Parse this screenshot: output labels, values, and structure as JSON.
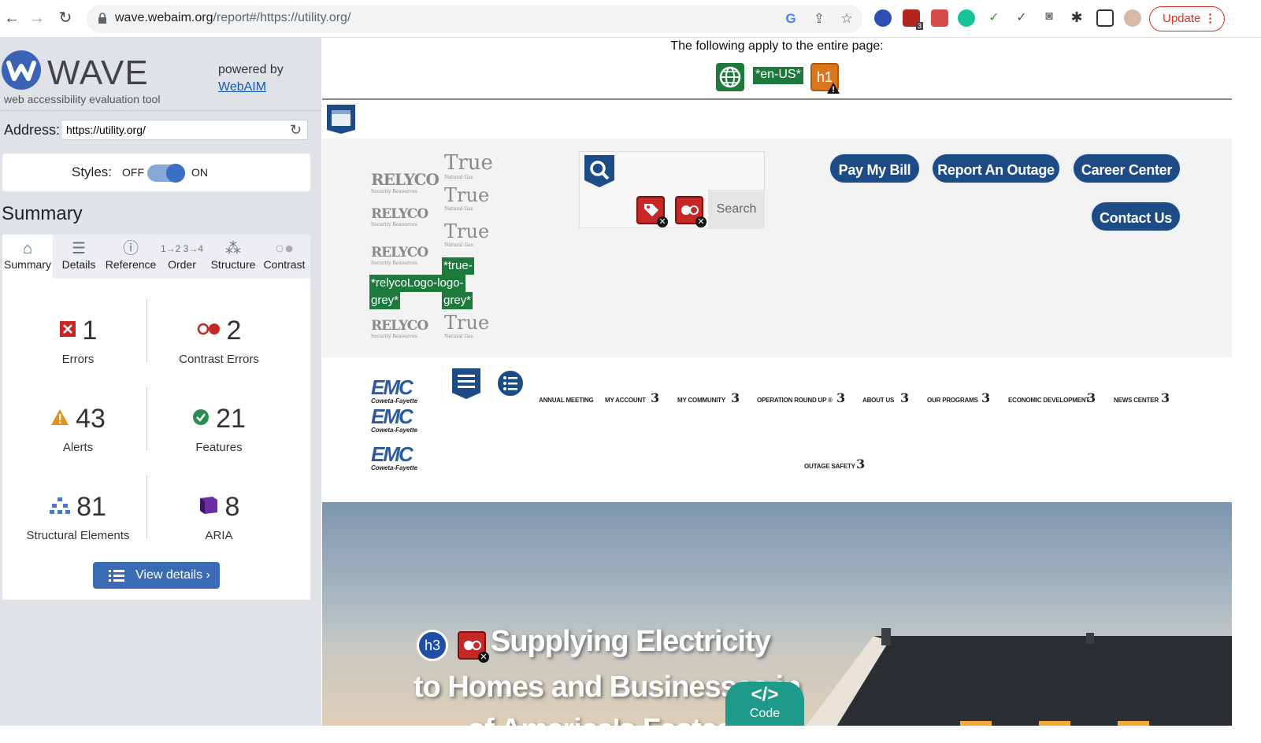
{
  "browser": {
    "url_host": "wave.webaim.org",
    "url_path": "/report#/https://utility.org/",
    "update_label": "Update",
    "ext_badge_count": "3"
  },
  "wave": {
    "logo_title": "WAVE",
    "logo_subtitle": "web accessibility evaluation tool",
    "powered_by": "powered by",
    "webaim_link": "WebAIM",
    "address_label": "Address:",
    "address_value": "https://utility.org/",
    "styles_label": "Styles:",
    "styles_off": "OFF",
    "styles_on": "ON",
    "summary_title": "Summary",
    "tabs": [
      {
        "label": "Summary",
        "icon": "home-icon"
      },
      {
        "label": "Details",
        "icon": "list-icon"
      },
      {
        "label": "Reference",
        "icon": "info-icon"
      },
      {
        "label": "Order",
        "icon": "order-icon"
      },
      {
        "label": "Structure",
        "icon": "structure-icon"
      },
      {
        "label": "Contrast",
        "icon": "contrast-icon"
      }
    ],
    "stats": {
      "errors": {
        "count": "1",
        "label": "Errors"
      },
      "contrast": {
        "count": "2",
        "label": "Contrast Errors"
      },
      "alerts": {
        "count": "43",
        "label": "Alerts"
      },
      "features": {
        "count": "21",
        "label": "Features"
      },
      "structural": {
        "count": "81",
        "label": "Structural Elements"
      },
      "aria": {
        "count": "8",
        "label": "ARIA"
      }
    },
    "view_details": "View details ›"
  },
  "page": {
    "applies_text": "The following apply to the entire page:",
    "lang_badge": "*en-US*",
    "h1_badge": "h1",
    "alt_true": "*true-",
    "alt_relyco": "*relycoLogo-logo-",
    "alt_grey1": "grey*",
    "alt_grey2": "grey*",
    "relyco_logo": "RELYCO",
    "relyco_sub": "Security Resources",
    "true_logo": "True",
    "true_sub": "Natural Gas",
    "search_label": "Search",
    "buttons": {
      "pay": "Pay My Bill",
      "outage": "Report An Outage",
      "career": "Career Center",
      "contact": "Contact Us"
    },
    "emc_logo": "EMC",
    "emc_sub": "Coweta-Fayette",
    "nav": [
      {
        "label": "ANNUAL MEETING",
        "num": ""
      },
      {
        "label": "MY ACCOUNT",
        "num": "3"
      },
      {
        "label": "MY COMMUNITY",
        "num": "3"
      },
      {
        "label": "OPERATION ROUND UP ®",
        "num": "3"
      },
      {
        "label": "ABOUT US",
        "num": "3"
      },
      {
        "label": "OUR PROGRAMS",
        "num": "3"
      },
      {
        "label": "ECONOMIC DEVELOPMENT",
        "num": "3"
      },
      {
        "label": "NEWS CENTER",
        "num": "3"
      }
    ],
    "nav_row2": {
      "label": "OUTAGE SAFETY",
      "num": "3"
    },
    "hero": {
      "h3": "h3",
      "line1": "Supplying Electricity",
      "line2": "to Homes and Businesses in",
      "line3": "of America's Fastest"
    },
    "code_glyph": "</>",
    "code_label": "Code"
  },
  "colors": {
    "wave_blue": "#3a63b8",
    "feature_green": "#1c7a3d",
    "error_red": "#c62828",
    "alert_orange": "#d9761e",
    "button_navy": "#1c4b86",
    "code_teal": "#1e9a8a"
  }
}
